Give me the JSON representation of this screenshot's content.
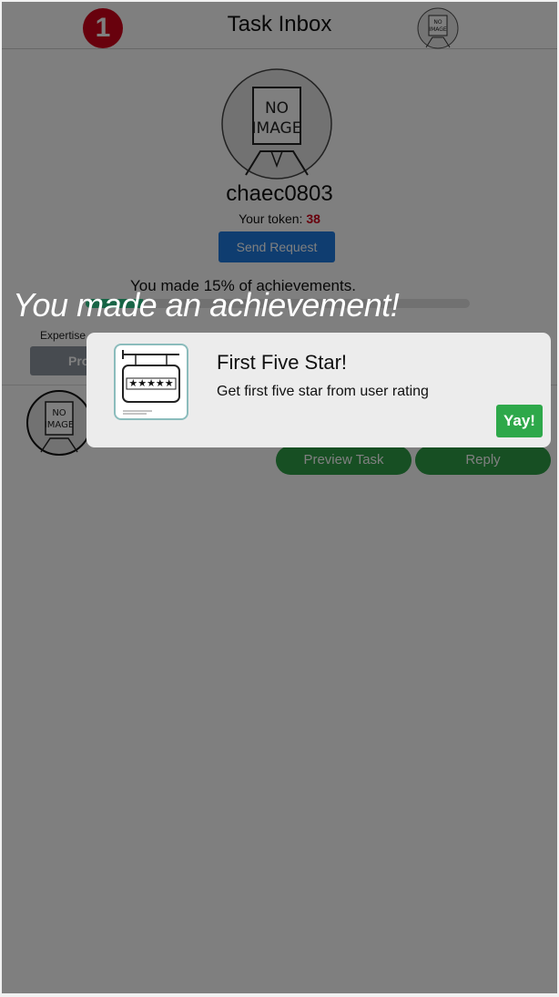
{
  "header": {
    "notification_count": "1",
    "title": "Task Inbox",
    "avatar_text": "NO IMAGE"
  },
  "profile": {
    "avatar_text": "NO IMAGE",
    "username": "chaec0803",
    "token_label": "Your token:",
    "token_value": "38",
    "send_request_label": "Send Request"
  },
  "achievements": {
    "text": "You made 15% of achievements.",
    "progress_fraction": 0.15
  },
  "expertise": {
    "label": "Expertise",
    "button_label": "Pro"
  },
  "task": {
    "avatar_text": "NO IMAGE",
    "preview_label": "Preview Task",
    "reply_label": "Reply"
  },
  "popup": {
    "banner": "You made an achievement!",
    "title": "First Five Star!",
    "description": "Get first five star from user rating",
    "confirm_label": "Yay!",
    "icon_name": "five-star-sign-icon",
    "stars": "★★★★★"
  },
  "colors": {
    "badge": "#d0021b",
    "primary_blue": "#1e7be0",
    "green": "#2e9e46",
    "progress": "#2ec98a",
    "yay": "#2ea84a"
  }
}
